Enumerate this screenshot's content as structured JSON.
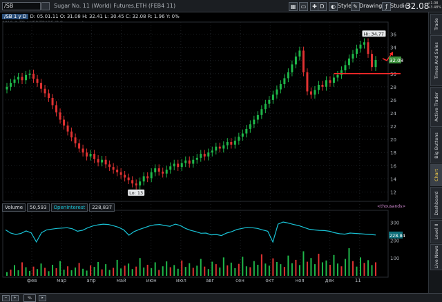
{
  "toolbar": {
    "symbol_value": "/SB",
    "description": "Sugar No. 11 (World) Futures,ETH (FEB4 11)",
    "style_label": "Style",
    "drawings_label": "Drawings",
    "studies_label": "Studies",
    "d_label": "D",
    "last_price": "32.08",
    "change_line1": "+1.08",
    "change_line2": "+3.48%"
  },
  "header": {
    "symbol_tag": "/SB 1 y D",
    "ohlc": "D: 05.01.11   O: 31.08   H: 32.41   L: 30.45   C: 32.08   R: 1.96   Y: 0%",
    "copyright": "2010 © TD AMERITRADE IP Company, Inc."
  },
  "sidebar": {
    "tabs": [
      "Trade",
      "Times And Sales",
      "Active Trader",
      "Big Buttons",
      "Chart",
      "Dashboard",
      "Level II",
      "Live News"
    ],
    "active_tab": "Chart"
  },
  "volume_panel": {
    "label": "Volume",
    "volume_value": "50,593",
    "oi_label": "OpenInterest",
    "oi_value": "228,837",
    "units": "<thousands>",
    "oi_badge": "228.84",
    "oi_color": "#19c3d6"
  },
  "bottombar": {
    "zoom": "%"
  },
  "colors": {
    "up": "#1fb84a",
    "down": "#e03232",
    "annotation": "#ff2a2a",
    "badge_bg": "#3b8f3b"
  },
  "chart_data": {
    "type": "line",
    "xlabels": [
      "фев",
      "мар",
      "апр",
      "май",
      "июн",
      "июл",
      "авг",
      "сен",
      "окт",
      "ноя",
      "дек",
      "11"
    ],
    "yticks": [
      12,
      14,
      16,
      18,
      20,
      22,
      24,
      26,
      28,
      30,
      32,
      34,
      36
    ],
    "ylim": [
      11,
      37
    ],
    "last_badge": "32.08",
    "hi_label": "Hi: 34.77",
    "lo_label": "Lo: 13",
    "hline_value": 30.0,
    "price": [
      28.0,
      28.6,
      29.1,
      29.5,
      29.0,
      29.8,
      30.0,
      29.2,
      28.6,
      27.7,
      27.0,
      26.3,
      25.2,
      24.1,
      23.0,
      22.1,
      21.2,
      20.3,
      19.4,
      18.6,
      18.0,
      17.4,
      17.8,
      17.0,
      16.5,
      16.9,
      16.2,
      15.8,
      15.4,
      15.0,
      14.6,
      14.2,
      13.8,
      13.3,
      13.0,
      13.6,
      14.4,
      14.1,
      15.0,
      15.6,
      15.1,
      14.8,
      15.4,
      15.9,
      16.3,
      15.8,
      16.4,
      16.8,
      16.3,
      16.9,
      17.2,
      17.8,
      17.4,
      18.0,
      18.3,
      18.9,
      18.6,
      19.1,
      19.6,
      19.2,
      19.8,
      20.4,
      20.9,
      21.6,
      22.3,
      23.0,
      23.7,
      24.6,
      25.4,
      26.0,
      26.8,
      27.6,
      28.4,
      29.3,
      30.2,
      31.4,
      32.6,
      33.5,
      30.2,
      27.3,
      26.8,
      27.5,
      28.3,
      28.0,
      29.0,
      28.6,
      29.4,
      29.8,
      30.5,
      31.3,
      32.3,
      33.0,
      33.8,
      34.4,
      34.77,
      33.0,
      31.0,
      32.08
    ],
    "open_interest": [
      258,
      240,
      232,
      238,
      252,
      241,
      190,
      242,
      258,
      262,
      266,
      268,
      270,
      264,
      250,
      256,
      270,
      280,
      286,
      290,
      288,
      281,
      272,
      258,
      228,
      248,
      260,
      270,
      280,
      286,
      288,
      282,
      278,
      290,
      282,
      266,
      255,
      248,
      239,
      240,
      230,
      232,
      226,
      240,
      248,
      260,
      266,
      272,
      270,
      266,
      258,
      250,
      190,
      290,
      302,
      296,
      288,
      282,
      272,
      262,
      258,
      255,
      254,
      250,
      242,
      236,
      234,
      240,
      238,
      236,
      234,
      232,
      229
    ],
    "volume": [
      12,
      20,
      35,
      18,
      44,
      28,
      16,
      30,
      22,
      40,
      26,
      15,
      36,
      25,
      48,
      20,
      31,
      18,
      27,
      42,
      23,
      17,
      34,
      29,
      45,
      21,
      38,
      19,
      26,
      52,
      24,
      33,
      40,
      22,
      30,
      58,
      27,
      36,
      25,
      44,
      19,
      31,
      47,
      28,
      35,
      23,
      50,
      29,
      41,
      26,
      33,
      55,
      30,
      22,
      46,
      38,
      27,
      60,
      34,
      43,
      25,
      39,
      62,
      31,
      28,
      48,
      36,
      70,
      40,
      33,
      57,
      45,
      38,
      29,
      66,
      41,
      52,
      35,
      80,
      46,
      58,
      38,
      72,
      44,
      50,
      36,
      68,
      40,
      31,
      55,
      90,
      48,
      30,
      60,
      42,
      51,
      35,
      44
    ],
    "oi_yticks": [
      100,
      200,
      300
    ],
    "oi_ylim": [
      0,
      360
    ]
  }
}
